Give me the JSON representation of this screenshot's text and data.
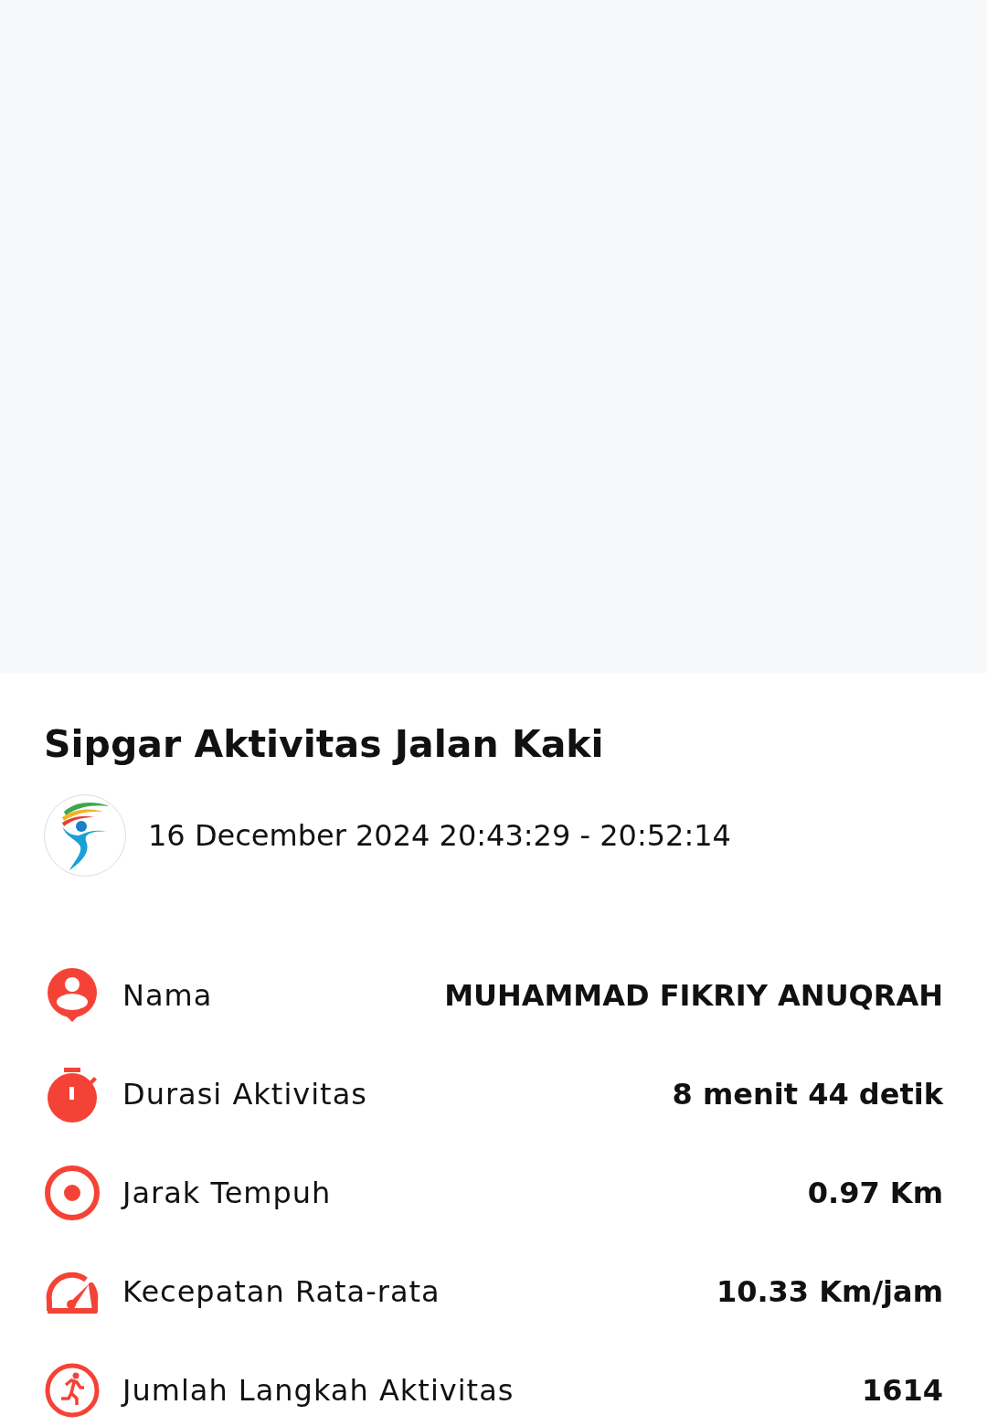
{
  "title": "Sipgar Aktivitas Jalan Kaki",
  "date_range": "16 December 2024 20:43:29 - 20:52:14",
  "stats": [
    {
      "kind": "person",
      "label": "Nama",
      "value": "MUHAMMAD FIKRIY ANUQRAH"
    },
    {
      "kind": "stopwatch",
      "label": "Durasi Aktivitas",
      "value": "8 menit 44 detik"
    },
    {
      "kind": "target",
      "label": "Jarak Tempuh",
      "value": "0.97 Km"
    },
    {
      "kind": "speed",
      "label": "Kecepatan Rata-rata",
      "value": "10.33 Km/jam"
    },
    {
      "kind": "runner",
      "label": "Jumlah Langkah Aktivitas",
      "value": "1614"
    }
  ]
}
